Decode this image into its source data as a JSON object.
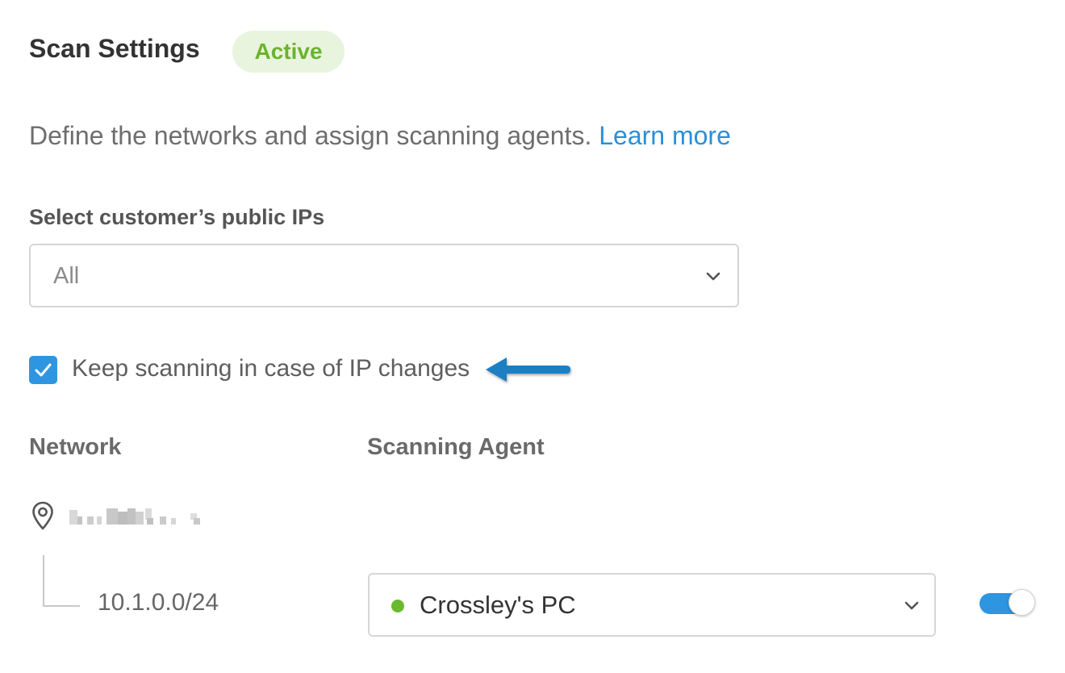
{
  "header": {
    "title": "Scan Settings",
    "status_badge": "Active"
  },
  "description": {
    "text": "Define the networks and assign scanning agents. ",
    "link_text": "Learn more"
  },
  "public_ips": {
    "label": "Select customer’s public IPs",
    "selected": "All"
  },
  "keep_scanning": {
    "checked": true,
    "label": "Keep scanning in case of IP changes"
  },
  "table": {
    "columns": [
      "Network",
      "Scanning Agent"
    ],
    "network_group": {
      "icon": "location-pin-icon",
      "name_redacted": true
    },
    "rows": [
      {
        "network": "10.1.0.0/24",
        "agent": "Crossley's PC",
        "agent_status": "online",
        "enabled": true
      }
    ]
  },
  "colors": {
    "accent": "#2e95e0",
    "link": "#2b8fd8",
    "active_badge_bg": "#e9f4de",
    "active_badge_text": "#6bb32e",
    "online_dot": "#6ab92f",
    "annotation_arrow": "#1f7fc4"
  }
}
